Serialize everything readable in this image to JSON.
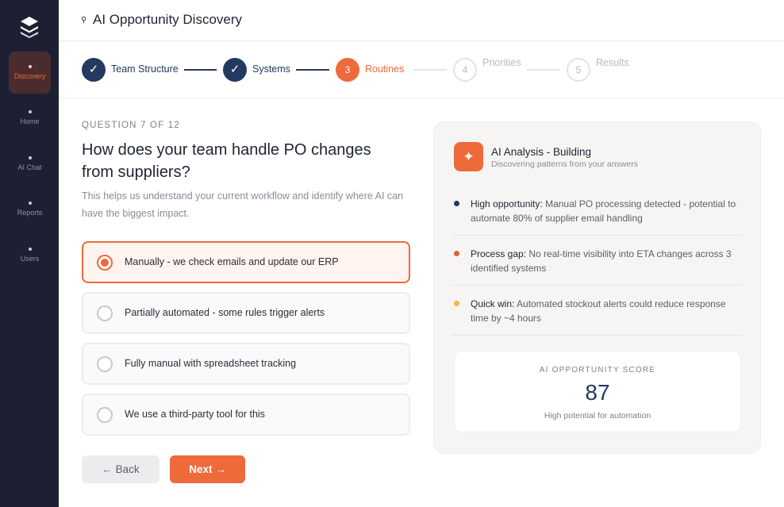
{
  "sidebar": {
    "items": [
      {
        "label": "Discovery",
        "active": true
      },
      {
        "label": "Home",
        "active": false
      },
      {
        "label": "AI Chat",
        "active": false
      },
      {
        "label": "Reports",
        "active": false
      },
      {
        "label": "Users",
        "active": false
      }
    ]
  },
  "header": {
    "icon": "search-icon",
    "title": "AI Opportunity Discovery"
  },
  "stepper": {
    "steps": [
      {
        "marker": "✓",
        "label": "Team Structure",
        "state": "done"
      },
      {
        "marker": "✓",
        "label": "Systems",
        "state": "done"
      },
      {
        "marker": "3",
        "label": "Routines",
        "state": "current"
      },
      {
        "marker": "4",
        "label": "Priorities",
        "state": "todo"
      },
      {
        "marker": "5",
        "label": "Results",
        "state": "todo"
      }
    ]
  },
  "question": {
    "eyebrow": "QUESTION 7 OF 12",
    "title": "How does your team handle PO changes from suppliers?",
    "help": "This helps us understand your current workflow and identify where AI can have the biggest impact.",
    "options": [
      {
        "label": "Manually - we check emails and update our ERP",
        "selected": true
      },
      {
        "label": "Partially automated - some rules trigger alerts",
        "selected": false
      },
      {
        "label": "Fully manual with spreadsheet tracking",
        "selected": false
      },
      {
        "label": "We use a third-party tool for this",
        "selected": false
      }
    ],
    "back_label": "← Back",
    "next_label": "Next →"
  },
  "analysis": {
    "icon": "sparkle-icon",
    "title": "AI Analysis - Building",
    "subtitle": "Discovering patterns from your answers",
    "insights": [
      {
        "tag": "High opportunity:",
        "text": " Manual PO processing detected - potential to automate 80% of supplier email handling",
        "color": "#24395f"
      },
      {
        "tag": "Process gap:",
        "text": " No real-time visibility into ETA changes across 3 identified systems",
        "color": "#e2602f"
      },
      {
        "tag": "Quick win:",
        "text": " Automated stockout alerts could reduce response time by ~4 hours",
        "color": "#f5b545"
      }
    ],
    "score": {
      "label": "AI OPPORTUNITY SCORE",
      "value": "87",
      "caption": "High potential for automation"
    }
  },
  "colors": {
    "accent": "#ee6a3a",
    "navy": "#24395f",
    "sidebar": "#1d2033"
  }
}
